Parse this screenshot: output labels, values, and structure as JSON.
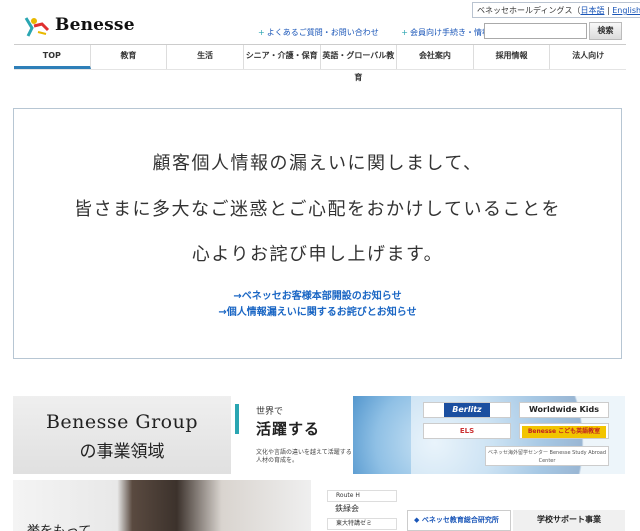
{
  "header": {
    "logo_text": "Benesse",
    "group_label": "ベネッセホールディングス（",
    "lang_japanese": "日本語",
    "lang_sep": " | ",
    "lang_english": "English",
    "group_close": "）",
    "links": [
      "よくあるご質問・お問い合わせ",
      "会員向け手続き・情報照会"
    ],
    "search_placeholder": "",
    "search_button": "検索"
  },
  "nav": {
    "items": [
      "TOP",
      "教育",
      "生活",
      "シニア・介護・保育",
      "英語・グローバル教育",
      "会社案内",
      "採用情報",
      "法人向け"
    ],
    "active": "TOP"
  },
  "apology": {
    "line1": "顧客個人情報の漏えいに関しまして、",
    "line2": "皆さまに多大なご迷惑とご心配をおかけしていることを",
    "line3": "心よりお詫び申し上げます。",
    "link1": "→ベネッセお客様本部開設のお知らせ",
    "link2": "→個人情報漏えいに関するお詫びとお知らせ"
  },
  "group_band": {
    "title_line1": "Benesse Group",
    "title_line2": "の事業領域",
    "panel_small": "世界で",
    "panel_big": "活躍する",
    "panel_desc": "文化や言語の違いを越えて活躍する人材の育成を。",
    "logos": {
      "berlitz": "Berlitz",
      "worldwide_kids": "Worldwide Kids",
      "els": "ELS",
      "kids_english": "Benesse こども英語教室",
      "abroad": "ベネッセ海外留学センター Benesse Study Abroad Center"
    }
  },
  "bottom_row": {
    "photo_text": "挙をもって",
    "side_logos": [
      "Route H",
      "鉄緑会",
      "東大特講ゼミ"
    ],
    "research_link": "ベネッセ教育総合研究所",
    "support_label": "学校サポート事業"
  }
}
